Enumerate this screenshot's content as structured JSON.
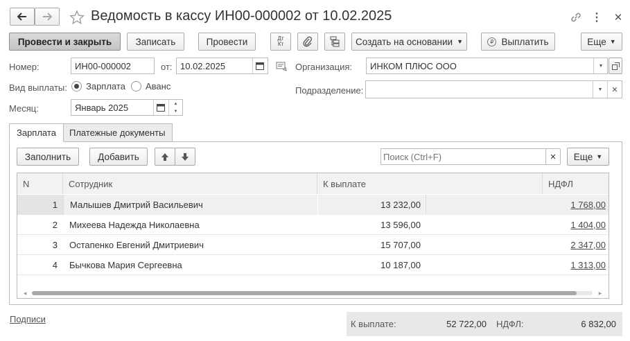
{
  "window": {
    "title": "Ведомость в кассу ИН00-000002 от 10.02.2025"
  },
  "toolbar": {
    "post_close": "Провести и закрыть",
    "save": "Записать",
    "post": "Провести",
    "dtkt": "Дт Кт",
    "create_based": "Создать на основании",
    "pay": "Выплатить",
    "more": "Еще"
  },
  "form": {
    "number_label": "Номер:",
    "number_value": "ИН00-000002",
    "date_label": "от:",
    "date_value": "10.02.2025",
    "org_label": "Организация:",
    "org_value": "ИНКОМ ПЛЮС ООО",
    "paytype_label": "Вид выплаты:",
    "paytype_options": [
      "Зарплата",
      "Аванс"
    ],
    "paytype_selected": "Зарплата",
    "dept_label": "Подразделение:",
    "dept_value": "",
    "month_label": "Месяц:",
    "month_value": "Январь 2025"
  },
  "tabs": [
    "Зарплата",
    "Платежные документы"
  ],
  "table_toolbar": {
    "fill": "Заполнить",
    "add": "Добавить",
    "search_placeholder": "Поиск (Ctrl+F)",
    "more": "Еще"
  },
  "table": {
    "columns": [
      "N",
      "Сотрудник",
      "К выплате",
      "НДФЛ"
    ],
    "rows": [
      {
        "n": "1",
        "employee": "Малышев Дмитрий Васильевич",
        "pay": "13 232,00",
        "ndfl": "1 768,00"
      },
      {
        "n": "2",
        "employee": "Михеева Надежда Николаевна",
        "pay": "13 596,00",
        "ndfl": "1 404,00"
      },
      {
        "n": "3",
        "employee": "Остапенко Евгений Дмитриевич",
        "pay": "15 707,00",
        "ndfl": "2 347,00"
      },
      {
        "n": "4",
        "employee": "Бычкова Мария Сергеевна",
        "pay": "10 187,00",
        "ndfl": "1 313,00"
      }
    ]
  },
  "footer": {
    "signatures": "Подписи",
    "total_pay_label": "К выплате:",
    "total_pay_value": "52 722,00",
    "total_ndfl_label": "НДФЛ:",
    "total_ndfl_value": "6 832,00"
  }
}
